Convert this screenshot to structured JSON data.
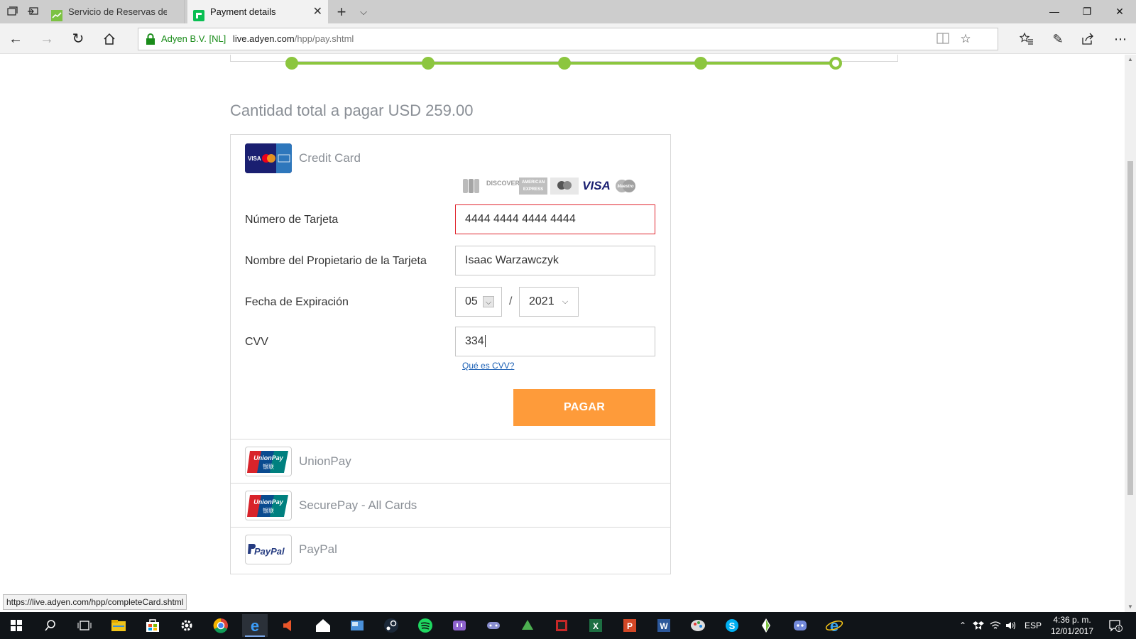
{
  "browser": {
    "tabs": [
      {
        "title": "Servicio de Reservas de Eura",
        "active": false,
        "favicon": "chart-favicon"
      },
      {
        "title": "Payment details",
        "active": true,
        "favicon": "adyen-favicon"
      }
    ],
    "cert_owner": "Adyen B.V. [NL]",
    "url_domain": "live.adyen.com",
    "url_path": "/hpp/pay.shtml",
    "status_url": "https://live.adyen.com/hpp/completeCard.shtml"
  },
  "page": {
    "total_label": "Cantidad total a pagar USD 259.00",
    "progress": {
      "steps": 5,
      "completed": 4,
      "current_step": 5
    }
  },
  "credit_card": {
    "label": "Credit Card",
    "brands": [
      "JCB",
      "DISCOVER",
      "AMERICAN EXPRESS",
      "MasterCard",
      "VISA",
      "Maestro"
    ],
    "card_number_label": "Número de Tarjeta",
    "card_number_value": "4444 4444 4444 4444",
    "holder_label": "Nombre del Propietario de la Tarjeta",
    "holder_value": "Isaac Warzawczyk",
    "expiry_label": "Fecha de Expiración",
    "expiry_month": "05",
    "expiry_separator": "/",
    "expiry_year": "2021",
    "cvv_label": "CVV",
    "cvv_value": "334",
    "cvv_help": "Qué es CVV?",
    "pay_button": "PAGAR"
  },
  "other_methods": [
    {
      "label": "UnionPay",
      "logo": "unionpay-logo"
    },
    {
      "label": "SecurePay - All Cards",
      "logo": "unionpay-logo"
    },
    {
      "label": "PayPal",
      "logo": "paypal-logo"
    }
  ],
  "logo_text": {
    "card_visa": "VISA",
    "unionpay": "UnionPay",
    "unionpay_cn": "银联",
    "paypal": "PayPal"
  },
  "taskbar": {
    "language": "ESP",
    "time": "4:36 p. m.",
    "date": "12/01/2017",
    "notifications": "1"
  },
  "colors": {
    "progress_green": "#8cc63f",
    "pay_button": "#fe9b3a",
    "error_border": "#e0262f",
    "label_grey": "#8a8f96"
  }
}
